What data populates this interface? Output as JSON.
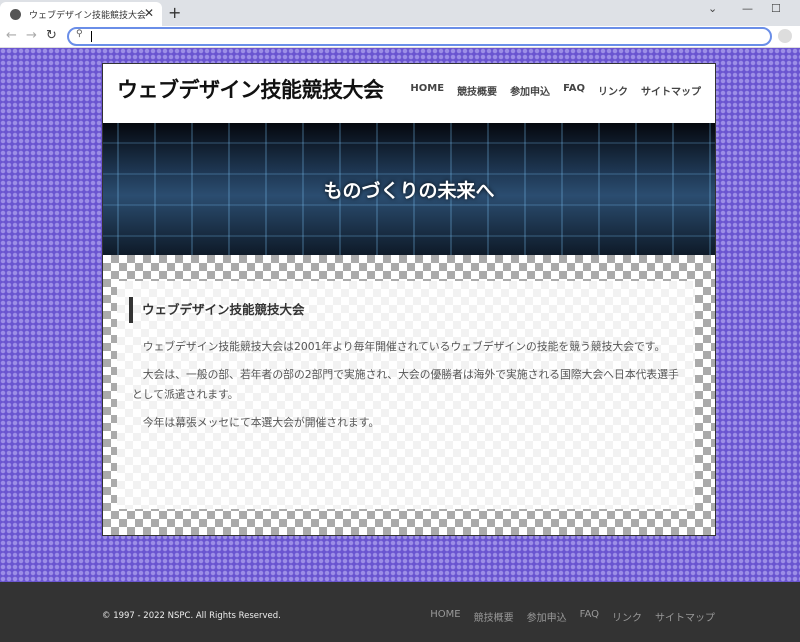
{
  "browser": {
    "tab_title": "ウェブデザイン技能競技大会",
    "close": "✕",
    "new_tab": "+",
    "address": ""
  },
  "site": {
    "title": "ウェブデザイン技能競技大会",
    "nav": [
      "HOME",
      "競技概要",
      "参加申込",
      "FAQ",
      "リンク",
      "サイトマップ"
    ],
    "hero": "ものづくりの未来へ",
    "heading": "ウェブデザイン技能競技大会",
    "paragraphs": [
      "ウェブデザイン技能競技大会は2001年より毎年開催されているウェブデザインの技能を競う競技大会です。",
      "大会は、一般の部、若年者の部の2部門で実施され、大会の優勝者は海外で実施される国際大会へ日本代表選手として派遣されます。",
      "今年は幕張メッセにて本選大会が開催されます。"
    ],
    "copyright": "© 1997 - 2022 NSPC. All Rights Reserved.",
    "footer_nav": [
      "HOME",
      "競技概要",
      "参加申込",
      "FAQ",
      "リンク",
      "サイトマップ"
    ]
  },
  "colors": {
    "background": "#6a55d0",
    "footer": "#333333"
  }
}
